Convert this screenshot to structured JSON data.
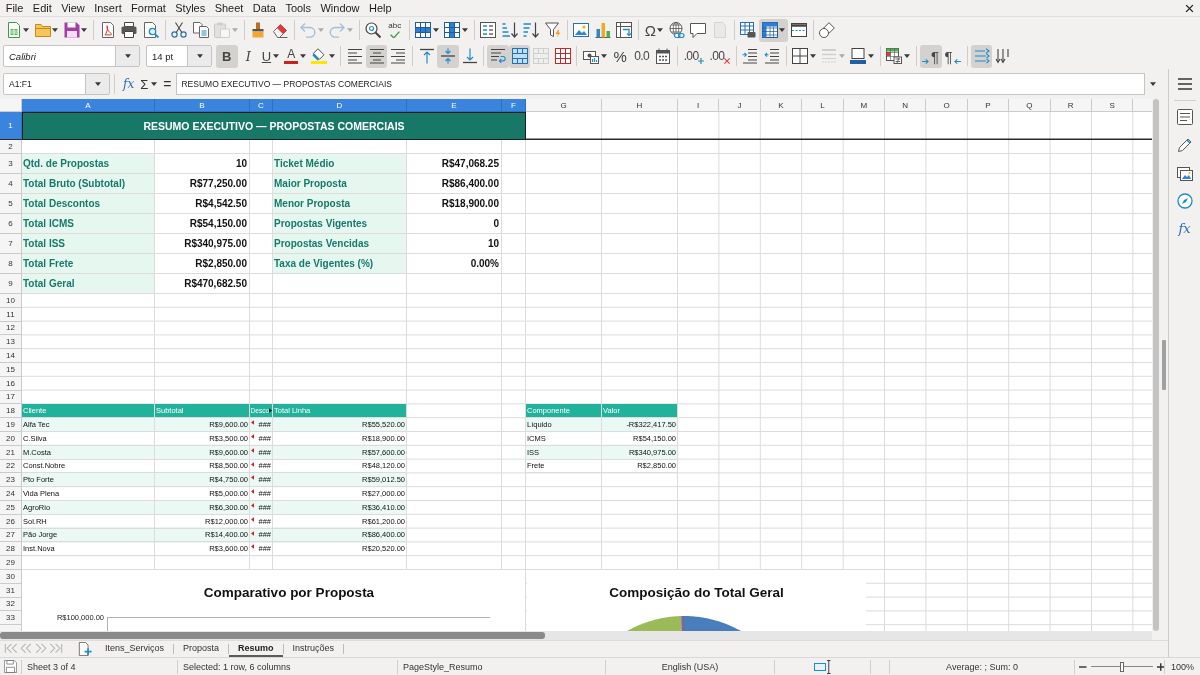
{
  "menu_bar": {
    "items": [
      "File",
      "Edit",
      "View",
      "Insert",
      "Format",
      "Styles",
      "Sheet",
      "Data",
      "Tools",
      "Window",
      "Help"
    ]
  },
  "standard_toolbar": {
    "buttons": [
      {
        "on": false,
        "disabled": false
      },
      {
        "on": false,
        "disabled": false
      },
      {
        "on": false,
        "disabled": false
      },
      {
        "on": false,
        "disabled": false
      },
      {
        "on": false,
        "disabled": false
      },
      {
        "on": false,
        "disabled": false
      },
      {
        "on": false,
        "disabled": false
      },
      {
        "on": false,
        "disabled": false
      },
      {
        "on": false,
        "disabled": true
      },
      {
        "on": false,
        "disabled": false
      },
      {
        "on": false,
        "disabled": false
      },
      {
        "on": false,
        "disabled": true
      },
      {
        "on": false,
        "disabled": true
      },
      {
        "on": false,
        "disabled": false
      },
      {
        "label": "abc",
        "on": false,
        "disabled": false
      },
      {
        "on": false,
        "disabled": false
      },
      {
        "on": false,
        "disabled": false
      },
      {
        "on": false,
        "disabled": false
      },
      {
        "on": false,
        "disabled": false
      },
      {
        "on": false,
        "disabled": false
      },
      {
        "on": false,
        "disabled": false
      },
      {
        "on": false,
        "disabled": false
      },
      {
        "on": false,
        "disabled": false
      },
      {
        "on": false,
        "disabled": false
      },
      {
        "label": "Ω",
        "on": false,
        "disabled": false
      },
      {
        "on": false,
        "disabled": false
      },
      {
        "on": false,
        "disabled": false
      },
      {
        "on": false,
        "disabled": true
      },
      {
        "on": false,
        "disabled": false
      },
      {
        "on": true,
        "disabled": false
      },
      {
        "on": false,
        "disabled": false
      },
      {
        "on": false,
        "disabled": false
      }
    ]
  },
  "formatting_toolbar": {
    "font_name": "Calibri",
    "font_size": "14 pt",
    "buttons": [
      {
        "label": "B",
        "on": true,
        "disabled": false
      },
      {
        "label": "I",
        "on": false,
        "disabled": false
      },
      {
        "label": "U",
        "on": false,
        "disabled": false
      },
      {
        "label": "A",
        "on": false,
        "disabled": false
      },
      {
        "on": false,
        "disabled": false
      },
      {
        "on": false,
        "disabled": false
      },
      {
        "on": true,
        "disabled": false
      },
      {
        "on": false,
        "disabled": false
      },
      {
        "on": false,
        "disabled": false
      },
      {
        "on": true,
        "disabled": false
      },
      {
        "on": false,
        "disabled": false
      },
      {
        "on": true,
        "disabled": false
      },
      {
        "on": true,
        "disabled": false
      },
      {
        "on": false,
        "disabled": true
      },
      {
        "on": false,
        "disabled": false
      },
      {
        "on": false,
        "disabled": false
      },
      {
        "label": "%",
        "on": false,
        "disabled": false
      },
      {
        "label": "0.0",
        "on": false,
        "disabled": false
      },
      {
        "on": false,
        "disabled": false
      },
      {
        "label": ".00",
        "on": false,
        "disabled": false
      },
      {
        "label": ".00",
        "on": false,
        "disabled": false
      },
      {
        "on": false,
        "disabled": false
      },
      {
        "on": false,
        "disabled": false
      },
      {
        "on": false,
        "disabled": false
      },
      {
        "on": false,
        "disabled": true
      },
      {
        "on": false,
        "disabled": false
      },
      {
        "on": false,
        "disabled": false
      },
      {
        "label": "¶",
        "on": true,
        "disabled": false
      },
      {
        "label": "¶",
        "on": false,
        "disabled": false
      },
      {
        "on": true,
        "disabled": false
      },
      {
        "on": false,
        "disabled": false
      }
    ]
  },
  "formula_bar": {
    "name_box": "A1:F1",
    "function_wizard": "fx",
    "sum": "Σ",
    "formula": "=",
    "content": "RESUMO EXECUTIVO — PROPOSTAS COMERCIAIS"
  },
  "sheet": {
    "columns": [
      {
        "label": "A",
        "selected": true
      },
      {
        "label": "B",
        "selected": true
      },
      {
        "label": "C",
        "selected": true
      },
      {
        "label": "D",
        "selected": true
      },
      {
        "label": "E",
        "selected": true
      },
      {
        "label": "F",
        "selected": true
      },
      {
        "label": "G",
        "selected": false
      },
      {
        "label": "H",
        "selected": false
      },
      {
        "label": "I",
        "selected": false
      },
      {
        "label": "J",
        "selected": false
      },
      {
        "label": "K",
        "selected": false
      },
      {
        "label": "L",
        "selected": false
      },
      {
        "label": "M",
        "selected": false
      },
      {
        "label": "N",
        "selected": false
      },
      {
        "label": "O",
        "selected": false
      },
      {
        "label": "P",
        "selected": false
      },
      {
        "label": "Q",
        "selected": false
      },
      {
        "label": "R",
        "selected": false
      },
      {
        "label": "S",
        "selected": false
      }
    ],
    "rows": [
      {
        "label": "1",
        "selected": true
      },
      {
        "label": "2",
        "selected": false
      },
      {
        "label": "3",
        "selected": false
      },
      {
        "label": "4",
        "selected": false
      },
      {
        "label": "5",
        "selected": false
      },
      {
        "label": "6",
        "selected": false
      },
      {
        "label": "7",
        "selected": false
      },
      {
        "label": "8",
        "selected": false
      },
      {
        "label": "9",
        "selected": false
      },
      {
        "label": "10",
        "selected": false
      },
      {
        "label": "11",
        "selected": false
      },
      {
        "label": "12",
        "selected": false
      },
      {
        "label": "13",
        "selected": false
      },
      {
        "label": "14",
        "selected": false
      },
      {
        "label": "15",
        "selected": false
      },
      {
        "label": "16",
        "selected": false
      },
      {
        "label": "17",
        "selected": false
      },
      {
        "label": "18",
        "selected": false
      },
      {
        "label": "19",
        "selected": false
      },
      {
        "label": "20",
        "selected": false
      },
      {
        "label": "21",
        "selected": false
      },
      {
        "label": "22",
        "selected": false
      },
      {
        "label": "23",
        "selected": false
      },
      {
        "label": "24",
        "selected": false
      },
      {
        "label": "25",
        "selected": false
      },
      {
        "label": "26",
        "selected": false
      },
      {
        "label": "27",
        "selected": false
      },
      {
        "label": "28",
        "selected": false
      },
      {
        "label": "29",
        "selected": false
      },
      {
        "label": "30",
        "selected": false
      },
      {
        "label": "31",
        "selected": false
      },
      {
        "label": "32",
        "selected": false
      },
      {
        "label": "33",
        "selected": false
      }
    ],
    "title": "RESUMO EXECUTIVO — PROPOSTAS COMERCIAIS",
    "summary_left": [
      {
        "label": "Qtd. de Propostas",
        "value": "10"
      },
      {
        "label": "Total Bruto (Subtotal)",
        "value": "R$77,250.00"
      },
      {
        "label": "Total Descontos",
        "value": "R$4,542.50"
      },
      {
        "label": "Total ICMS",
        "value": "R$54,150.00"
      },
      {
        "label": "Total ISS",
        "value": "R$340,975.00"
      },
      {
        "label": "Total Frete",
        "value": "R$2,850.00"
      },
      {
        "label": "Total Geral",
        "value": "R$470,682.50"
      }
    ],
    "summary_right": [
      {
        "label": "Ticket Médio",
        "value": "R$47,068.25"
      },
      {
        "label": "Maior Proposta",
        "value": "R$86,400.00"
      },
      {
        "label": "Menor Proposta",
        "value": "R$18,900.00"
      },
      {
        "label": "Propostas Vigentes",
        "value": "0"
      },
      {
        "label": "Propostas Vencidas",
        "value": "10"
      },
      {
        "label": "Taxa de Vigentes (%)",
        "value": "0.00%"
      }
    ],
    "clients_table": {
      "columns": [
        {
          "label": "Cliente",
          "clipped": false
        },
        {
          "label": "Subtotal",
          "clipped": false
        },
        {
          "label": "Desco",
          "clipped": true
        },
        {
          "label": "Total Linha",
          "clipped": false
        }
      ],
      "rows": [
        [
          "Alfa Tec",
          "R$9,600.00",
          "###",
          "R$55,520.00"
        ],
        [
          "C.Silva",
          "R$3,500.00",
          "###",
          "R$18,900.00"
        ],
        [
          "M.Costa",
          "R$9,600.00",
          "###",
          "R$57,600.00"
        ],
        [
          "Const.Nobre",
          "R$8,500.00",
          "###",
          "R$48,120.00"
        ],
        [
          "Pto Forte",
          "R$4,750.00",
          "###",
          "R$59,012.50"
        ],
        [
          "Vida Plena",
          "R$5,000.00",
          "###",
          "R$27,000.00"
        ],
        [
          "AgroRio",
          "R$6,300.00",
          "###",
          "R$36,410.00"
        ],
        [
          "Sol.RH",
          "R$12,000.00",
          "###",
          "R$61,200.00"
        ],
        [
          "Pão Jorge",
          "R$14,400.00",
          "###",
          "R$86,400.00"
        ],
        [
          "Inst.Nova",
          "R$3,600.00",
          "###",
          "R$20,520.00"
        ]
      ]
    },
    "components_table": {
      "columns": [
        "Componente",
        "Valor"
      ],
      "rows": [
        [
          "Líquido",
          "-R$322,417.50"
        ],
        [
          "ICMS",
          "R$54,150.00"
        ],
        [
          "ISS",
          "R$340,975.00"
        ],
        [
          "Frete",
          "R$2,850.00"
        ]
      ]
    },
    "charts": [
      {
        "kind": "bar",
        "title": "Comparativo por Proposta",
        "tick_labels": [
          "R$100,000.00"
        ]
      },
      {
        "kind": "pie",
        "title": "Composição do Total Geral"
      }
    ]
  },
  "sheet_tabs": {
    "navigation": [
      {
        "disabled": true
      },
      {
        "disabled": true
      },
      {
        "disabled": true
      },
      {
        "disabled": true
      }
    ],
    "tabs": [
      {
        "label": "Itens_Serviços",
        "selected": false
      },
      {
        "label": "Proposta",
        "selected": false
      },
      {
        "label": "Resumo",
        "selected": true
      },
      {
        "label": "Instruções",
        "selected": false
      }
    ]
  },
  "sidebar": {
    "functions_tab": "fx"
  },
  "status_bar": {
    "sheet_position": "Sheet 3 of 4",
    "selection": "Selected: 1 row, 6 columns",
    "page_style": "PageStyle_Resumo",
    "language": "English (USA)",
    "statistics": "Average: ; Sum: 0",
    "zoom_slider": {
      "level": 0.5
    },
    "zoom": "100%"
  }
}
